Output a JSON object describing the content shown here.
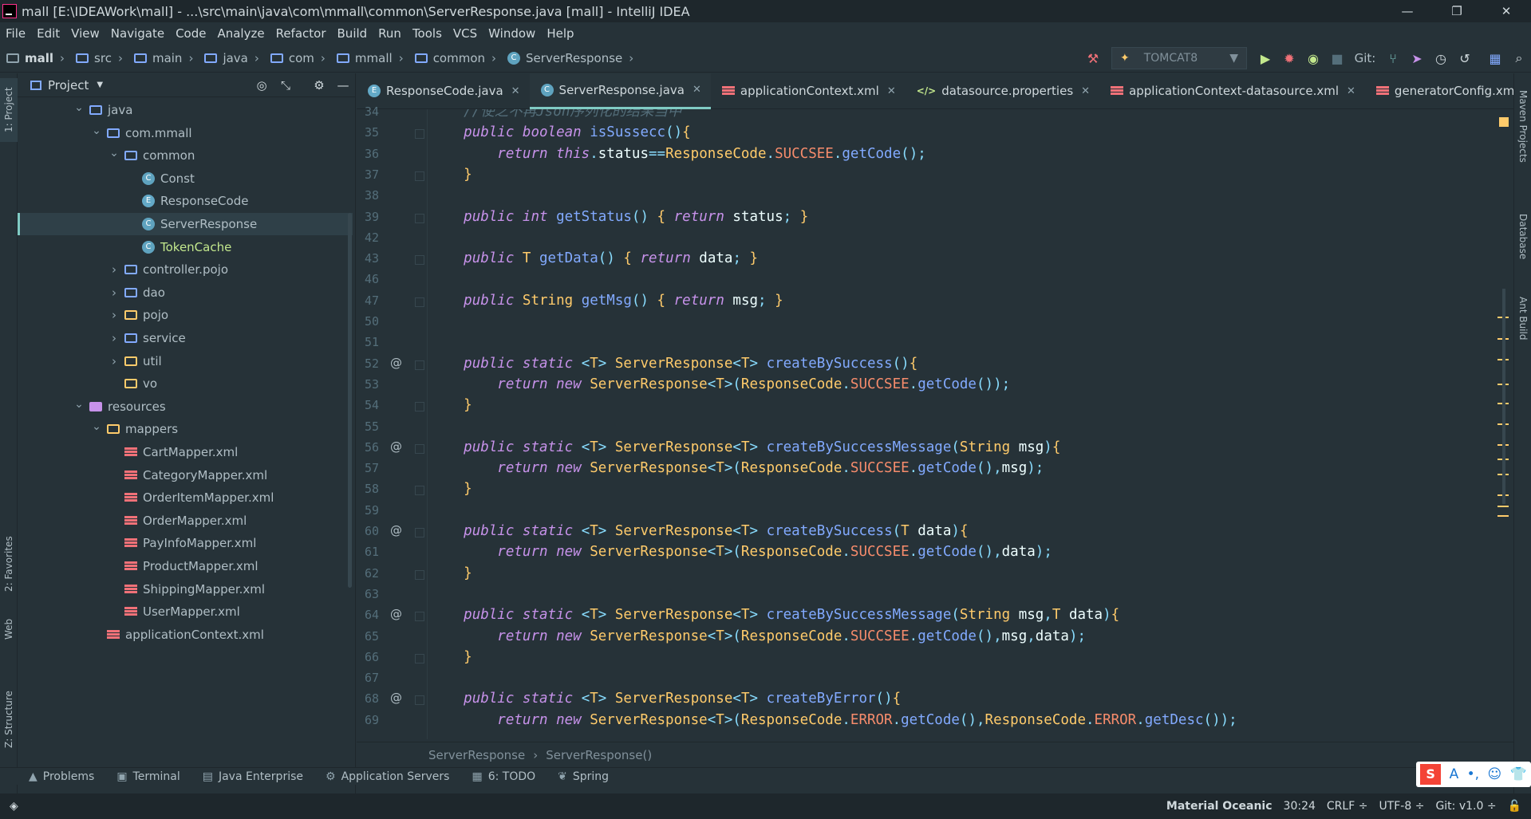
{
  "window": {
    "title": "mall [E:\\IDEAWork\\mall] - ...\\src\\main\\java\\com\\mmall\\common\\ServerResponse.java [mall] - IntelliJ IDEA",
    "minimize": "—",
    "restore": "❐",
    "close": "✕"
  },
  "menu": [
    "File",
    "Edit",
    "View",
    "Navigate",
    "Code",
    "Analyze",
    "Refactor",
    "Build",
    "Run",
    "Tools",
    "VCS",
    "Window",
    "Help"
  ],
  "navbar": {
    "crumbs": [
      "mall",
      "src",
      "main",
      "java",
      "com",
      "mmall",
      "common",
      "ServerResponse"
    ],
    "run_config": "TOMCAT8",
    "git_label": "Git:"
  },
  "left_stripe": {
    "project": "1: Project",
    "favorites": "2: Favorites",
    "web": "Web",
    "structure": "Z: Structure"
  },
  "right_stripe": {
    "maven": "Maven Projects",
    "database": "Database",
    "ant": "Ant Build"
  },
  "project": {
    "title": "Project",
    "tree": [
      {
        "label": "java",
        "indent": 0,
        "chev": "down",
        "icon": "folder-blue"
      },
      {
        "label": "com.mmall",
        "indent": 1,
        "chev": "down",
        "icon": "folder"
      },
      {
        "label": "common",
        "indent": 2,
        "chev": "down",
        "icon": "folder"
      },
      {
        "label": "Const",
        "indent": 3,
        "chev": "",
        "icon": "class"
      },
      {
        "label": "ResponseCode",
        "indent": 3,
        "chev": "",
        "icon": "enum"
      },
      {
        "label": "ServerResponse",
        "indent": 3,
        "chev": "",
        "icon": "class",
        "selected": true
      },
      {
        "label": "TokenCache",
        "indent": 3,
        "chev": "",
        "icon": "class",
        "green": true
      },
      {
        "label": "controller.pojo",
        "indent": 2,
        "chev": "right",
        "icon": "folder"
      },
      {
        "label": "dao",
        "indent": 2,
        "chev": "right",
        "icon": "folder"
      },
      {
        "label": "pojo",
        "indent": 2,
        "chev": "right",
        "icon": "folder-orange"
      },
      {
        "label": "service",
        "indent": 2,
        "chev": "right",
        "icon": "folder"
      },
      {
        "label": "util",
        "indent": 2,
        "chev": "right",
        "icon": "folder-orange"
      },
      {
        "label": "vo",
        "indent": 2,
        "chev": "",
        "icon": "folder-orange"
      },
      {
        "label": "resources",
        "indent": 0,
        "chev": "down",
        "icon": "resources"
      },
      {
        "label": "mappers",
        "indent": 1,
        "chev": "down",
        "icon": "folder-orange"
      },
      {
        "label": "CartMapper.xml",
        "indent": 2,
        "chev": "",
        "icon": "xml"
      },
      {
        "label": "CategoryMapper.xml",
        "indent": 2,
        "chev": "",
        "icon": "xml"
      },
      {
        "label": "OrderItemMapper.xml",
        "indent": 2,
        "chev": "",
        "icon": "xml"
      },
      {
        "label": "OrderMapper.xml",
        "indent": 2,
        "chev": "",
        "icon": "xml"
      },
      {
        "label": "PayInfoMapper.xml",
        "indent": 2,
        "chev": "",
        "icon": "xml"
      },
      {
        "label": "ProductMapper.xml",
        "indent": 2,
        "chev": "",
        "icon": "xml"
      },
      {
        "label": "ShippingMapper.xml",
        "indent": 2,
        "chev": "",
        "icon": "xml"
      },
      {
        "label": "UserMapper.xml",
        "indent": 2,
        "chev": "",
        "icon": "xml"
      },
      {
        "label": "applicationContext.xml",
        "indent": 1,
        "chev": "",
        "icon": "xml"
      }
    ]
  },
  "tabs": [
    {
      "label": "ResponseCode.java",
      "icon": "enum"
    },
    {
      "label": "ServerResponse.java",
      "icon": "class",
      "active": true
    },
    {
      "label": "applicationContext.xml",
      "icon": "xml"
    },
    {
      "label": "datasource.properties",
      "icon": "props"
    },
    {
      "label": "applicationContext-datasource.xml",
      "icon": "xml"
    },
    {
      "label": "generatorConfig.xml",
      "icon": "xml"
    }
  ],
  "tabs_more": "⋮",
  "gutter": {
    "line_numbers": [
      "34",
      "35",
      "36",
      "37",
      "38",
      "39",
      "42",
      "43",
      "46",
      "47",
      "50",
      "51",
      "52",
      "53",
      "54",
      "55",
      "56",
      "57",
      "58",
      "59",
      "60",
      "61",
      "62",
      "63",
      "64",
      "65",
      "66",
      "67",
      "68",
      "69"
    ]
  },
  "code_lines": [
    "    //使之不再Json序列化的结果当中",
    "    public boolean isSussecc(){",
    "        return this.status==ResponseCode.SUCCSEE.getCode();",
    "    }",
    "",
    "    public int getStatus() { return status; }",
    "",
    "    public T getData() { return data; }",
    "",
    "    public String getMsg() { return msg; }",
    "",
    "",
    "    public static <T> ServerResponse<T> createBySuccess(){",
    "        return new ServerResponse<T>(ResponseCode.SUCCSEE.getCode());",
    "    }",
    "",
    "    public static <T> ServerResponse<T> createBySuccessMessage(String msg){",
    "        return new ServerResponse<T>(ResponseCode.SUCCSEE.getCode(),msg);",
    "    }",
    "",
    "    public static <T> ServerResponse<T> createBySuccess(T data){",
    "        return new ServerResponse<T>(ResponseCode.SUCCSEE.getCode(),data);",
    "    }",
    "",
    "    public static <T> ServerResponse<T> createBySuccessMessage(String msg,T data){",
    "        return new ServerResponse<T>(ResponseCode.SUCCSEE.getCode(),msg,data);",
    "    }",
    "",
    "    public static <T> ServerResponse<T> createByError(){",
    "        return new ServerResponse<T>(ResponseCode.ERROR.getCode(),ResponseCode.ERROR.getDesc());"
  ],
  "editor_breadcrumb": [
    "ServerResponse",
    "ServerResponse()"
  ],
  "bottom_tools": [
    {
      "label": "Problems",
      "icon": "▲"
    },
    {
      "label": "Terminal",
      "icon": "▣"
    },
    {
      "label": "Java Enterprise",
      "icon": "▤"
    },
    {
      "label": "Application Servers",
      "icon": "⚙"
    },
    {
      "label": "6: TODO",
      "icon": "▦"
    },
    {
      "label": "Spring",
      "icon": "❦"
    }
  ],
  "status": {
    "theme": "Material Oceanic",
    "position": "30:24",
    "line_sep": "CRLF ÷",
    "encoding": "UTF-8 ÷",
    "git": "Git: v1.0 ÷"
  },
  "colors": {
    "background": "#263238",
    "accent": "#80CBC4",
    "keyword": "#C792EA",
    "type": "#FFCB6B",
    "function": "#82AAFF",
    "constant": "#F78C6C"
  }
}
